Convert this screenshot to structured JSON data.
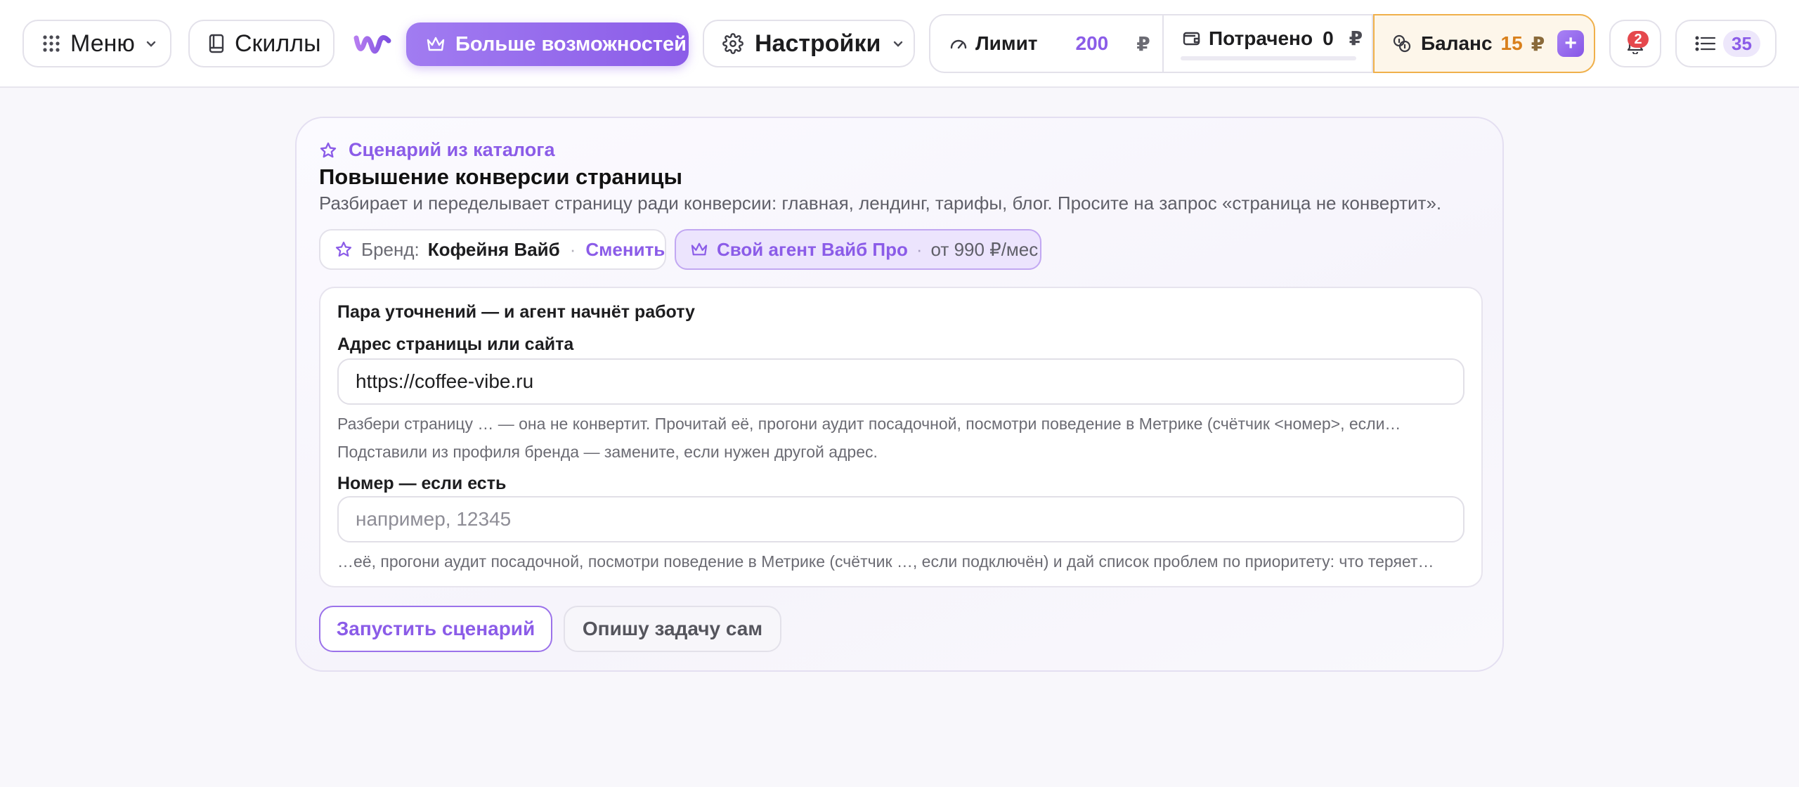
{
  "header": {
    "menu_label": "Меню",
    "skills_label": "Скиллы",
    "pro_label": "Больше возможностей",
    "settings_label": "Настройки",
    "limit": {
      "label": "Лимит",
      "value": "200",
      "currency": "₽"
    },
    "spent": {
      "label": "Потрачено",
      "value": "0",
      "currency": "₽",
      "progress": 0
    },
    "balance": {
      "label": "Баланс",
      "value": "15",
      "currency": "₽",
      "add": "+"
    },
    "notifications_count": "2",
    "tasks_count": "35"
  },
  "card": {
    "eyebrow": "Сценарий из каталога",
    "title": "Повышение конверсии страницы",
    "subtitle": "Разбирает и переделывает страницу ради конверсии: главная, лендинг, тарифы, блог. Просите на запрос «страница не конвертит».",
    "brand": {
      "key": "Бренд:",
      "value": "Кофейня Вайб",
      "separator": "·",
      "action": "Сменить"
    },
    "agent": {
      "label": "Свой агент Вайб Про",
      "separator": "·",
      "price": "от 990 ₽/мес"
    },
    "form": {
      "heading": "Пара уточнений — и агент начнёт работу",
      "field1": {
        "label": "Адрес страницы или сайта",
        "value": "https://coffee-vibe.ru",
        "hint1": "Разбери страницу … — она не конвертит. Прочитай её, прогони аудит посадочной, посмотри поведение в Метрике (счётчик <номер>, если…",
        "hint2": "Подставили из профиля бренда — замените, если нужен другой адрес."
      },
      "field2": {
        "label": "Номер — если есть",
        "placeholder": "например, 12345",
        "hint": "…её, прогони аудит посадочной, посмотри поведение в Метрике (счётчик …, если подключён) и дай список проблем по приоритету: что теряет…"
      }
    },
    "run_label": "Запустить сценарий",
    "self_label": "Опишу задачу сам"
  },
  "colors": {
    "accent": "#8b5ce8",
    "balance": "#d9801c",
    "badge": "#e5484d"
  }
}
